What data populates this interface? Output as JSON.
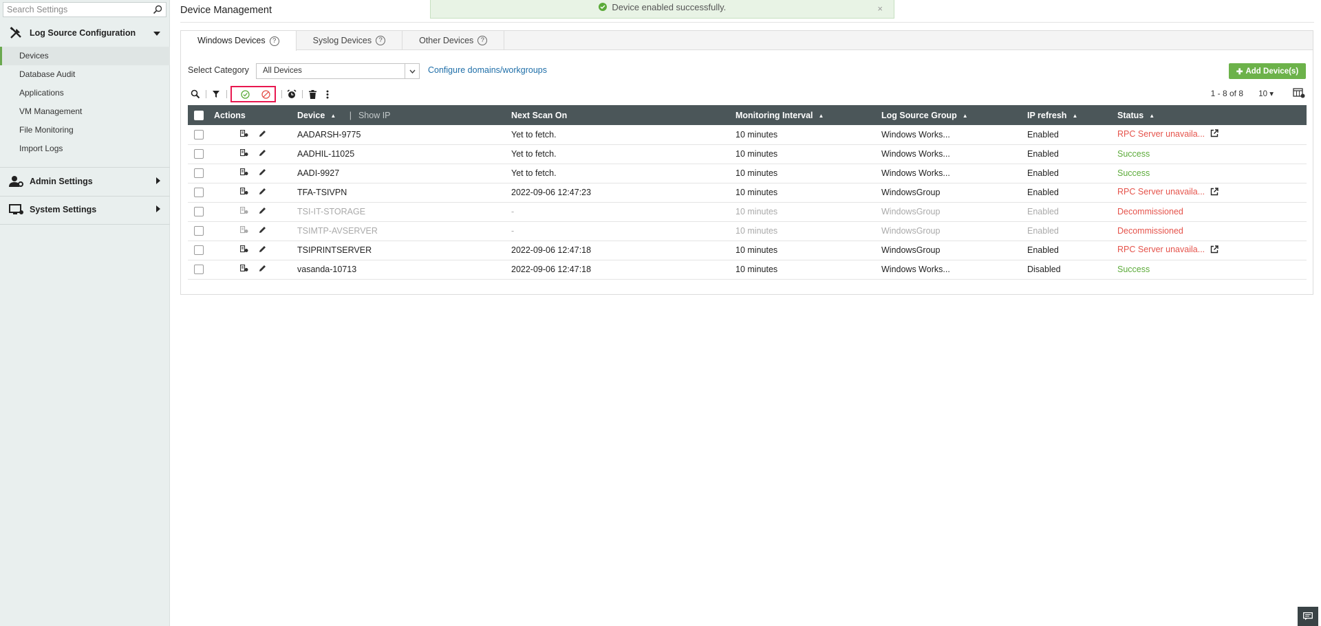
{
  "sidebar": {
    "search_placeholder": "Search Settings",
    "groups": [
      {
        "label": "Log Source Configuration",
        "icon": "tools-icon",
        "expanded": true,
        "items": [
          "Devices",
          "Database Audit",
          "Applications",
          "VM Management",
          "File Monitoring",
          "Import Logs"
        ],
        "active_item": "Devices"
      },
      {
        "label": "Admin Settings",
        "icon": "admin-user-icon",
        "expanded": false
      },
      {
        "label": "System Settings",
        "icon": "system-monitor-icon",
        "expanded": false
      }
    ]
  },
  "header": {
    "title": "Device Management"
  },
  "toast": {
    "message": "Device enabled successfully.",
    "close": "×"
  },
  "tabs": [
    {
      "label": "Windows Devices",
      "help": "?"
    },
    {
      "label": "Syslog Devices",
      "help": "?"
    },
    {
      "label": "Other Devices",
      "help": "?"
    }
  ],
  "filter": {
    "category_label": "Select Category",
    "category_value": "All Devices",
    "configure_link": "Configure domains/workgroups",
    "add_button": "Add Device(s)"
  },
  "toolbar": {
    "pager": "1 - 8 of 8",
    "per_page": "10"
  },
  "table": {
    "columns": {
      "actions": "Actions",
      "device": "Device",
      "show_ip": "Show IP",
      "next_scan": "Next Scan On",
      "interval": "Monitoring Interval",
      "group": "Log Source Group",
      "ip_refresh": "IP refresh",
      "status": "Status"
    },
    "rows": [
      {
        "device": "AADARSH-9775",
        "next_scan": "Yet to fetch.",
        "interval": "10 minutes",
        "group": "Windows Works...",
        "ip_refresh": "Enabled",
        "status": "RPC Server unavaila...",
        "status_type": "error",
        "dim": false
      },
      {
        "device": "AADHIL-11025",
        "next_scan": "Yet to fetch.",
        "interval": "10 minutes",
        "group": "Windows Works...",
        "ip_refresh": "Enabled",
        "status": "Success",
        "status_type": "success",
        "dim": false
      },
      {
        "device": "AADI-9927",
        "next_scan": "Yet to fetch.",
        "interval": "10 minutes",
        "group": "Windows Works...",
        "ip_refresh": "Enabled",
        "status": "Success",
        "status_type": "success",
        "dim": false
      },
      {
        "device": "TFA-TSIVPN",
        "next_scan": "2022-09-06 12:47:23",
        "interval": "10 minutes",
        "group": "WindowsGroup",
        "ip_refresh": "Enabled",
        "status": "RPC Server unavaila...",
        "status_type": "error",
        "dim": false
      },
      {
        "device": "TSI-IT-STORAGE",
        "next_scan": "-",
        "interval": "10 minutes",
        "group": "WindowsGroup",
        "ip_refresh": "Enabled",
        "status": "Decommissioned",
        "status_type": "decom",
        "dim": true
      },
      {
        "device": "TSIMTP-AVSERVER",
        "next_scan": "-",
        "interval": "10 minutes",
        "group": "WindowsGroup",
        "ip_refresh": "Enabled",
        "status": "Decommissioned",
        "status_type": "decom",
        "dim": true
      },
      {
        "device": "TSIPRINTSERVER",
        "next_scan": "2022-09-06 12:47:18",
        "interval": "10 minutes",
        "group": "WindowsGroup",
        "ip_refresh": "Enabled",
        "status": "RPC Server unavaila...",
        "status_type": "error",
        "dim": false
      },
      {
        "device": "vasanda-10713",
        "next_scan": "2022-09-06 12:47:18",
        "interval": "10 minutes",
        "group": "Windows Works...",
        "ip_refresh": "Disabled",
        "status": "Success",
        "status_type": "success",
        "dim": false
      }
    ]
  },
  "colors": {
    "accent_green": "#6cb24a",
    "error_red": "#e5534b",
    "header_dark": "#4b5659",
    "highlight": "#e8174f",
    "link": "#1e6ea8"
  }
}
